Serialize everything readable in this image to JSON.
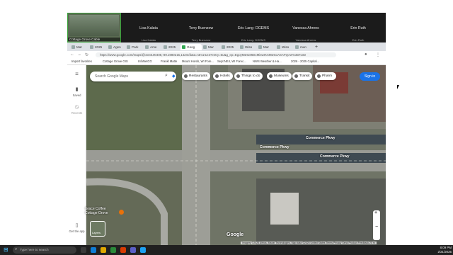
{
  "participants": {
    "self": {
      "name": "Cottage Grove Cable"
    },
    "tiles": [
      {
        "name": "Lisa Kalata",
        "sub": "Lisa Kalata"
      },
      {
        "name": "Terry Buenzow",
        "sub": "Terry Buenzow"
      },
      {
        "name": "Eric Lang- DGEMS",
        "sub": "Eric Lang- DGEMS"
      },
      {
        "name": "Vanessa Ahrens",
        "sub": "Vanessa Ahrens"
      },
      {
        "name": "Erin Ruth",
        "sub": "Erin Ruth"
      }
    ]
  },
  "browser": {
    "tabs": [
      "Mar",
      "2025",
      "Agen",
      "Park",
      "Ame",
      "2025",
      "Goog",
      "Mar",
      "2025",
      "Wiso",
      "Mar",
      "Wiso",
      "mun"
    ],
    "active_tab": 6,
    "url": "https://www.google.com/maps/@43.0100408,-89.1980215,142m/data=!3m1!1e3?entry=ttu&g_ep=EgoyMDI1MDIxMi4wIKXMDSoASAFQAw%3D%3D",
    "bookmarks": [
      "Import favorites",
      "Cottage Grove GIS",
      "InfoNetCG",
      "Frankl Matte",
      "Mount Horeb, WI Fore...",
      "Sept NE4, WI Forec...",
      "NWS Weather & Ha...",
      "2026 - 2025 Capital..."
    ]
  },
  "maps": {
    "search_placeholder": "Search Google Maps",
    "chips": [
      "Restaurants",
      "Hotels",
      "Things to do",
      "Museums",
      "Transit",
      "Pharm"
    ],
    "signin": "Sign in",
    "rail": {
      "saved": "Saved",
      "recents": "Recents",
      "get_app": "Get the app"
    },
    "road_labels": [
      "Commerce Pkwy",
      "Commerce Pkwy",
      "Commerce Pkwy"
    ],
    "place_label": "Grace Coffee\nCottage Grove",
    "brand": "Google",
    "attribution": "Imagery ©2025 Airbus, Maxar Technologies, Map data ©2025   United States   Terms   Privacy   Send Product Feedback   20 m",
    "layers_label": "Layers"
  },
  "taskbar": {
    "search": "Type here to search",
    "time": "8:09 PM",
    "date": "2/21/2025"
  },
  "colors": {
    "meeting_bg": "#1f1f1f",
    "signin": "#1a73e8",
    "taskbar": "#202020"
  }
}
